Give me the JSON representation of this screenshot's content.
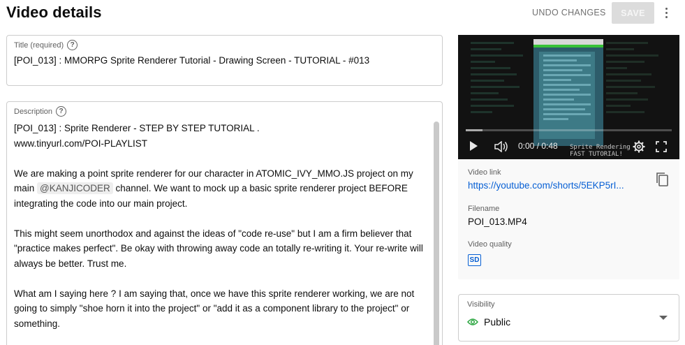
{
  "header": {
    "title": "Video details",
    "undo_label": "UNDO CHANGES",
    "save_label": "SAVE",
    "more_icon": "more-vert-icon"
  },
  "title_field": {
    "label": "Title (required)",
    "value": "[POI_013] : MMORPG Sprite Renderer Tutorial - Drawing Screen - TUTORIAL - #013"
  },
  "description_field": {
    "label": "Description",
    "lines": {
      "l1": "[POI_013] : Sprite Renderer - STEP BY STEP TUTORIAL .",
      "l2": "www.tinyurl.com/POI-PLAYLIST",
      "p1_before": "We are making a point sprite renderer for our character in ATOMIC_IVY_MMO.JS project on my main ",
      "p1_mention": "@KANJICODER",
      "p1_after": " channel. We want to mock up a basic sprite renderer project BEFORE integrating the code into our main project.",
      "p2": "This might seem unorthodox and against the ideas of \"code re-use\" but I am a firm believer that \"practice makes perfect\". Be okay with throwing away code an totally re-writing it. Your re-write will always be better. Trust me.",
      "p3": "What am I saying here ? I am saying that, once we have this sprite renderer working, we are not going to simply \"shoe horn it into the project\" or \"add it as a component library to the project\" or something."
    }
  },
  "video": {
    "time": "0:00 / 0:48",
    "overlay_text": "Sprite Rendering\nFAST TUTORIAL!",
    "progress": 0.0
  },
  "video_info": {
    "link_label": "Video link",
    "link_value": "https://youtube.com/shorts/5EKP5rI...",
    "filename_label": "Filename",
    "filename_value": "POI_013.MP4",
    "quality_label": "Video quality",
    "quality_badge": "SD"
  },
  "visibility": {
    "label": "Visibility",
    "value": "Public"
  },
  "colors": {
    "accent": "#065fd4",
    "public_green": "#2ba640"
  }
}
